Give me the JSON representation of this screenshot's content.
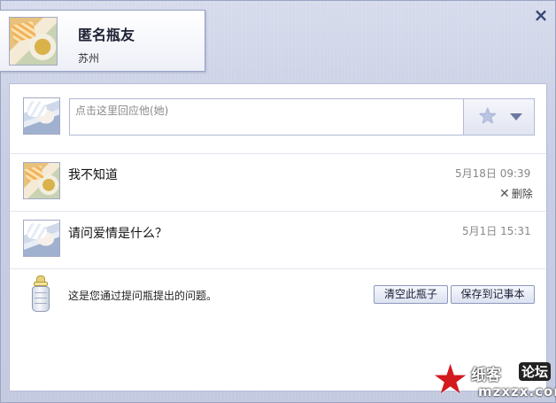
{
  "window": {
    "close_label": "×"
  },
  "profile": {
    "name": "匿名瓶友",
    "city": "苏州"
  },
  "reply": {
    "placeholder": "点击这里回应他(她)"
  },
  "messages": [
    {
      "text": "我不知道",
      "time": "5月18日 09:39",
      "delete_label": "删除",
      "avatar": "tea-avatar"
    },
    {
      "text": "请问爱情是什么？",
      "time": "5月1日 15:31",
      "avatar": "boy-avatar"
    }
  ],
  "footer": {
    "note": "这是您通过提问瓶提出的问题。",
    "clear_button": "清空此瓶子",
    "save_button": "保存到记事本"
  },
  "watermark": {
    "brand": "纸客",
    "forum": "论坛",
    "domain": "mzxzx.com"
  },
  "icons": {
    "close": "close-icon",
    "emoji": "star-wand-icon",
    "dropdown": "chevron-down-icon",
    "delete": "x-icon",
    "bottle": "baby-bottle-icon",
    "watermark": "red-star-logo"
  },
  "colors": {
    "frame": "#c7cde3",
    "panel": "#ffffff",
    "border": "#9aa3c6",
    "time_text": "#888888",
    "watermark_red": "#d21a1f"
  }
}
